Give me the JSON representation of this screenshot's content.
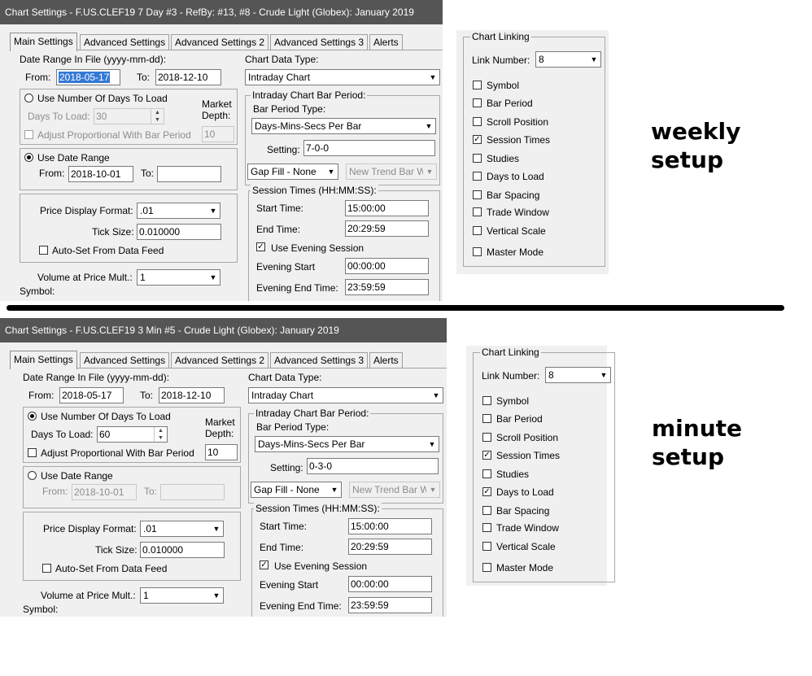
{
  "dialogs": [
    {
      "title": "Chart Settings - F.US.CLEF19  7 Day   #3 - RefBy: #13, #8 - Crude Light (Globex): January 2019",
      "tabs": [
        "Main Settings",
        "Advanced Settings",
        "Advanced Settings 2",
        "Advanced Settings 3",
        "Alerts"
      ],
      "date_range_label": "Date Range In File (yyyy-mm-dd):",
      "from_label": "From:",
      "from_value": "2018-05-17",
      "to_label": "To:",
      "to_value": "2018-12-10",
      "use_days_label": "Use Number Of Days To Load",
      "days_to_load_label": "Days To Load:",
      "days_to_load_value": "30",
      "market_depth_label_1": "Market",
      "market_depth_label_2": "Depth:",
      "market_depth_value": "10",
      "adjust_label": "Adjust Proportional With Bar Period",
      "use_date_range_label": "Use Date Range",
      "range_from_label": "From:",
      "range_from_value": "2018-10-01",
      "range_to_label": "To:",
      "range_to_value": "",
      "price_format_label": "Price Display Format:",
      "price_format_value": ".01",
      "tick_size_label": "Tick Size:",
      "tick_size_value": "0.010000",
      "auto_set_label": "Auto-Set From Data Feed",
      "volume_label": "Volume at Price Mult.:",
      "volume_value": "1",
      "symbol_label": "Symbol:",
      "chart_data_type_label": "Chart Data Type:",
      "chart_data_type_value": "Intraday Chart",
      "bar_period_group_label": "Intraday Chart Bar Period:",
      "bar_period_type_label": "Bar Period Type:",
      "bar_period_type_value": "Days-Mins-Secs Per Bar",
      "setting_label": "Setting:",
      "setting_value": "7-0-0",
      "gap_fill_value": "Gap Fill - None",
      "new_trend_value": "New Trend Bar W",
      "session_group_label": "Session Times (HH:MM:SS):",
      "start_time_label": "Start Time:",
      "start_time_value": "15:00:00",
      "end_time_label": "End Time:",
      "end_time_value": "20:29:59",
      "use_evening_label": "Use Evening Session",
      "evening_start_label": "Evening Start",
      "evening_start_value": "00:00:00",
      "evening_end_label": "Evening End Time:",
      "evening_end_value": "23:59:59",
      "state": {
        "use_days_selected": false,
        "use_date_range_selected": true,
        "days_enabled": false,
        "date_range_enabled": true,
        "from_selected": true,
        "adjust_checked": false,
        "auto_set_checked": false,
        "use_evening_checked": true
      }
    },
    {
      "title": "Chart Settings - F.US.CLEF19  3 Min   #5 - Crude Light (Globex): January 2019",
      "tabs": [
        "Main Settings",
        "Advanced Settings",
        "Advanced Settings 2",
        "Advanced Settings 3",
        "Alerts"
      ],
      "date_range_label": "Date Range In File (yyyy-mm-dd):",
      "from_label": "From:",
      "from_value": "2018-05-17",
      "to_label": "To:",
      "to_value": "2018-12-10",
      "use_days_label": "Use Number Of Days To Load",
      "days_to_load_label": "Days To Load:",
      "days_to_load_value": "60",
      "market_depth_label_1": "Market",
      "market_depth_label_2": "Depth:",
      "market_depth_value": "10",
      "adjust_label": "Adjust Proportional With Bar Period",
      "use_date_range_label": "Use Date Range",
      "range_from_label": "From:",
      "range_from_value": "2018-10-01",
      "range_to_label": "To:",
      "range_to_value": "",
      "price_format_label": "Price Display Format:",
      "price_format_value": ".01",
      "tick_size_label": "Tick Size:",
      "tick_size_value": "0.010000",
      "auto_set_label": "Auto-Set From Data Feed",
      "volume_label": "Volume at Price Mult.:",
      "volume_value": "1",
      "symbol_label": "Symbol:",
      "chart_data_type_label": "Chart Data Type:",
      "chart_data_type_value": "Intraday Chart",
      "bar_period_group_label": "Intraday Chart Bar Period:",
      "bar_period_type_label": "Bar Period Type:",
      "bar_period_type_value": "Days-Mins-Secs Per Bar",
      "setting_label": "Setting:",
      "setting_value": "0-3-0",
      "gap_fill_value": "Gap Fill - None",
      "new_trend_value": "New Trend Bar W",
      "session_group_label": "Session Times (HH:MM:SS):",
      "start_time_label": "Start Time:",
      "start_time_value": "15:00:00",
      "end_time_label": "End Time:",
      "end_time_value": "20:29:59",
      "use_evening_label": "Use Evening Session",
      "evening_start_label": "Evening Start",
      "evening_start_value": "00:00:00",
      "evening_end_label": "Evening End Time:",
      "evening_end_value": "23:59:59",
      "state": {
        "use_days_selected": true,
        "use_date_range_selected": false,
        "days_enabled": true,
        "date_range_enabled": false,
        "from_selected": false,
        "adjust_checked": false,
        "auto_set_checked": false,
        "use_evening_checked": true
      }
    }
  ],
  "linking_panels": [
    {
      "title": "Chart Linking",
      "link_number_label": "Link Number:",
      "link_number_value": "8",
      "items": [
        {
          "label": "Symbol",
          "checked": false
        },
        {
          "label": "Bar Period",
          "checked": false
        },
        {
          "label": "Scroll Position",
          "checked": false
        },
        {
          "label": "Session Times",
          "checked": true
        },
        {
          "label": "Studies",
          "checked": false
        },
        {
          "label": "Days to Load",
          "checked": false
        },
        {
          "label": "Bar Spacing",
          "checked": false
        },
        {
          "label": "Trade Window",
          "checked": false
        },
        {
          "label": "Vertical Scale",
          "checked": false
        },
        {
          "label": "Master Mode",
          "checked": false
        }
      ]
    },
    {
      "title": "Chart Linking",
      "link_number_label": "Link Number:",
      "link_number_value": "8",
      "items": [
        {
          "label": "Symbol",
          "checked": false
        },
        {
          "label": "Bar Period",
          "checked": false
        },
        {
          "label": "Scroll Position",
          "checked": false
        },
        {
          "label": "Session Times",
          "checked": true
        },
        {
          "label": "Studies",
          "checked": false
        },
        {
          "label": "Days to Load",
          "checked": true
        },
        {
          "label": "Bar Spacing",
          "checked": false
        },
        {
          "label": "Trade Window",
          "checked": false
        },
        {
          "label": "Vertical Scale",
          "checked": false
        },
        {
          "label": "Master Mode",
          "checked": false
        }
      ]
    }
  ],
  "annotations": {
    "weekly_line1": "weekly",
    "weekly_line2": "setup",
    "minute_line1": "minute",
    "minute_line2": "setup"
  }
}
